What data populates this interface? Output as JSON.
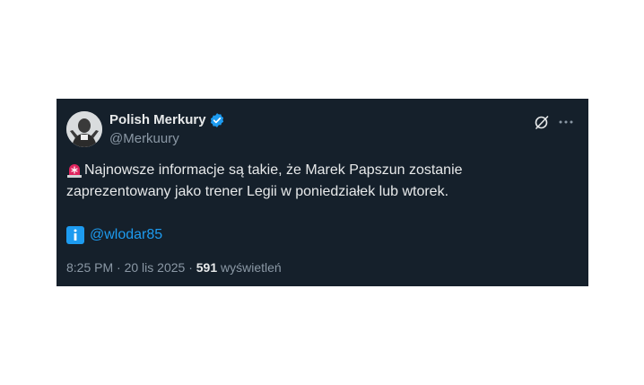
{
  "tweet": {
    "author": {
      "name": "Polish Merkury",
      "handle": "@Merkuury",
      "verified": true
    },
    "text": {
      "line1": "Najnowsze informacje są takie, że Marek Papszun zostanie",
      "line2": "zaprezentowany jako trener Legii w poniedziałek lub wtorek."
    },
    "mention": "@wlodar85",
    "meta": {
      "time": "8:25 PM",
      "separator": "·",
      "date": "20 lis 2025",
      "views_count": "591",
      "views_label": "wyświetleń"
    },
    "icons": {
      "siren": "police-light-icon",
      "info": "information-icon",
      "verified": "verified-badge-icon",
      "grok": "grok-icon",
      "more": "more-horizontal-icon"
    },
    "colors": {
      "background": "#15202b",
      "primary_text": "#e7e9ea",
      "secondary_text": "#8b98a5",
      "link": "#1d9bf0",
      "verified": "#1d9bf0"
    }
  }
}
